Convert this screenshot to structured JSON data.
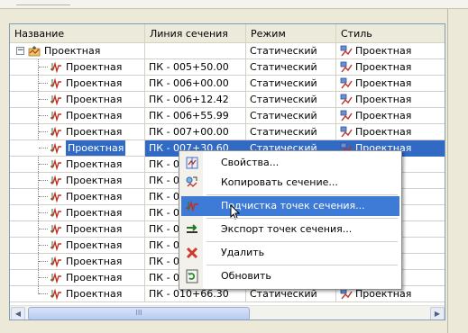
{
  "columns": [
    "Название",
    "Линия сечения",
    "Режим",
    "Стиль"
  ],
  "root": {
    "name": "Проектная",
    "mode": "Статический",
    "style": "Проектная"
  },
  "rows": [
    {
      "name": "Проектная",
      "line": "ПК - 005+50.00",
      "mode": "Статический",
      "style": "Проектная"
    },
    {
      "name": "Проектная",
      "line": "ПК - 006+00.00",
      "mode": "Статический",
      "style": "Проектная"
    },
    {
      "name": "Проектная",
      "line": "ПК - 006+12.42",
      "mode": "Статический",
      "style": "Проектная"
    },
    {
      "name": "Проектная",
      "line": "ПК - 006+55.99",
      "mode": "Статический",
      "style": "Проектная"
    },
    {
      "name": "Проектная",
      "line": "ПК - 007+00.00",
      "mode": "Статический",
      "style": "Проектная"
    },
    {
      "name": "Проектная",
      "line": "ПК - 007+30.60",
      "mode": "Статический",
      "style": "Проектная",
      "selected": true
    },
    {
      "name": "Проектная",
      "line": "ПК - 007+00.00",
      "mode": "",
      "style": ""
    },
    {
      "name": "Проектная",
      "line": "ПК - 008+00.00",
      "mode": "",
      "style": ""
    },
    {
      "name": "Проектная",
      "line": "ПК - 008+00.00",
      "mode": "",
      "style": ""
    },
    {
      "name": "Проектная",
      "line": "ПК - 008+50.00",
      "mode": "",
      "style": ""
    },
    {
      "name": "Проектная",
      "line": "ПК - 009+00.00",
      "mode": "",
      "style": ""
    },
    {
      "name": "Проектная",
      "line": "ПК - 009+00.00",
      "mode": "",
      "style": ""
    },
    {
      "name": "Проектная",
      "line": "ПК - 009+50.00",
      "mode": "",
      "style": ""
    },
    {
      "name": "Проектная",
      "line": "ПК - 010+00.00",
      "mode": "",
      "style": ""
    },
    {
      "name": "Проектная",
      "line": "ПК - 010+66.30",
      "mode": "Статический",
      "style": "Проектная"
    }
  ],
  "scrollbar": {
    "thumb_grip": "III",
    "left_arrow": "◀",
    "right_arrow": "▶"
  },
  "context_menu": {
    "items": [
      {
        "label": "Свойства...",
        "icon": "properties-icon"
      },
      {
        "label": "Копировать сечение...",
        "icon": "copy-section-icon"
      },
      {
        "label": "Подчистка точек сечения...",
        "icon": "section-line-icon",
        "highlighted": true
      },
      {
        "label": "Экспорт точек сечения...",
        "icon": "export-arrow-icon"
      },
      {
        "label": "Удалить",
        "icon": "delete-x-icon"
      },
      {
        "label": "Обновить",
        "icon": "refresh-icon"
      }
    ]
  },
  "colors": {
    "selection": "#316ac5",
    "menu_highlight": "#3d7bd6",
    "header_bg": "#ebeadb",
    "delete_red": "#d03a2b"
  }
}
